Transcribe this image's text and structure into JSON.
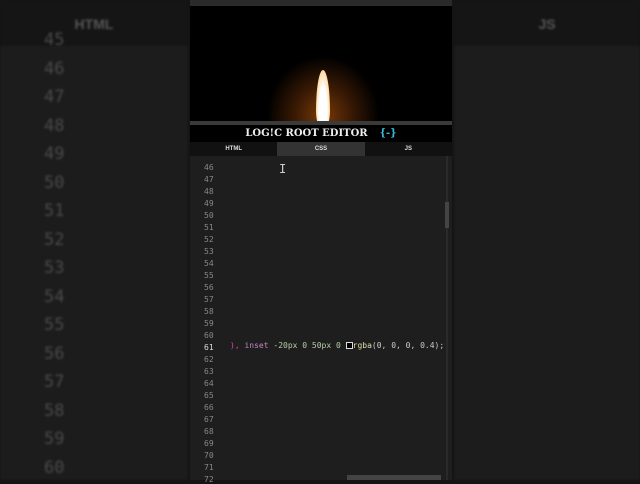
{
  "background": {
    "left_tab": "HTML",
    "right_tab": "JS",
    "line_numbers": [
      "45",
      "46",
      "47",
      "48",
      "49",
      "50",
      "51",
      "52",
      "53",
      "54",
      "55",
      "56",
      "57",
      "58",
      "59",
      "60"
    ]
  },
  "title": "LOG!C ROOT EDITOR",
  "title_icon": "{-}",
  "tabs": [
    {
      "label": "HTML"
    },
    {
      "label": "CSS"
    },
    {
      "label": "JS"
    }
  ],
  "active_tab": "CSS",
  "editor": {
    "line_numbers": [
      "46",
      "47",
      "48",
      "49",
      "50",
      "51",
      "52",
      "53",
      "54",
      "55",
      "56",
      "57",
      "58",
      "59",
      "60",
      "61",
      "62",
      "63",
      "64",
      "65",
      "66",
      "67",
      "68",
      "69",
      "70",
      "71",
      "72"
    ],
    "current_line": "61",
    "code": {
      "paren": "),",
      "kw": "inset",
      "nums": "-20px 0 50px 0",
      "fn": "rgba",
      "args": "(0, 0, 0, 0.4);"
    }
  },
  "colors": {
    "accent": "#3ab8d8",
    "flame": "#e88b2a"
  }
}
